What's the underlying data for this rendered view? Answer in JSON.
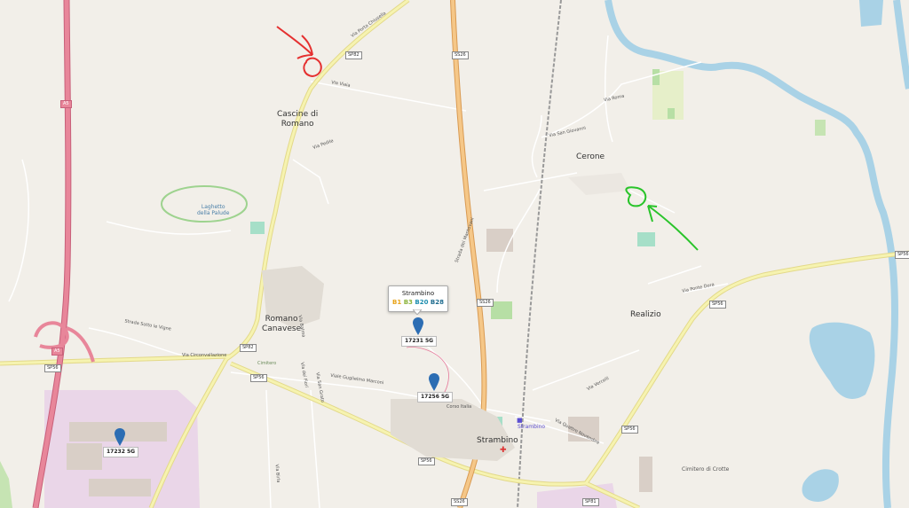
{
  "places": {
    "cascine_line1": "Cascine di",
    "cascine_line2": "Romano",
    "cerone": "Cerone",
    "romano_line1": "Romano",
    "romano_line2": "Canavese",
    "realizio": "Realizio",
    "strambino": "Strambino",
    "strambino_station": "Strambino",
    "laghetto_line1": "Laghetto",
    "laghetto_line2": "della Palude",
    "cimitero": "Cimitero",
    "cimitero_crotte": "Cimitero di Crotte"
  },
  "roads": {
    "via_viaia": "Via Viaia",
    "via_roma": "Via Roma",
    "via_san_giovanni": "Via San Giovanni",
    "via_circonvallazione": "Via Circonvallazione",
    "viale_marconi": "Viale Guglielmo Marconi",
    "via_ponte_dora": "Via Ponte Dora",
    "strada_sotto_le_vigne": "Strada Sotto le Vigne",
    "corso_italia": "Corso Italia",
    "via_vercelli": "Via Vercelli",
    "via_quattro_novembre": "Via Quattro Novembre",
    "via_carlo_torino": "Via Pedile",
    "strada_mantovani": "Strada del Mantovani",
    "via_san_grato": "Via San Grato",
    "via_dei_fiori": "Via dei Fiori",
    "via_birla": "Via Birla",
    "via_balma": "Via Balma",
    "via_pozzo": "Via Porta Chiusella"
  },
  "shields": {
    "a5_top": "A5",
    "a5_bottom": "A5",
    "sp82_top": "SP82",
    "sp82_bottom": "SP82",
    "s26_top": "SS26",
    "s26_mid": "SS26",
    "s26_bottom": "SS26",
    "sp56_left": "SP56",
    "sp56_mid": "SP56",
    "sp56_center": "SP56",
    "sp56_right": "SP56",
    "sp56_se": "SP56",
    "sp81": "SP81"
  },
  "popup": {
    "title": "Strambino",
    "bands": [
      {
        "label": "B1",
        "color": "#e8a317"
      },
      {
        "label": "B3",
        "color": "#8bb33a"
      },
      {
        "label": "B20",
        "color": "#1f8fb0"
      },
      {
        "label": "B28",
        "color": "#1f6c8f"
      }
    ]
  },
  "markers": {
    "m1": "17231 5G",
    "m2": "17256 5G",
    "m3": "17232 5G"
  },
  "annotations": {
    "red_arrow_color": "#e53030",
    "green_arrow_color": "#29c42a"
  },
  "colors": {
    "land": "#f2efe9",
    "water": "#a9d2e6",
    "motorway": "#e8869a",
    "trunk": "#f5b56b",
    "secondary": "#f2f0a0",
    "industrial": "#ead6e8",
    "marker": "#2c6db3"
  }
}
